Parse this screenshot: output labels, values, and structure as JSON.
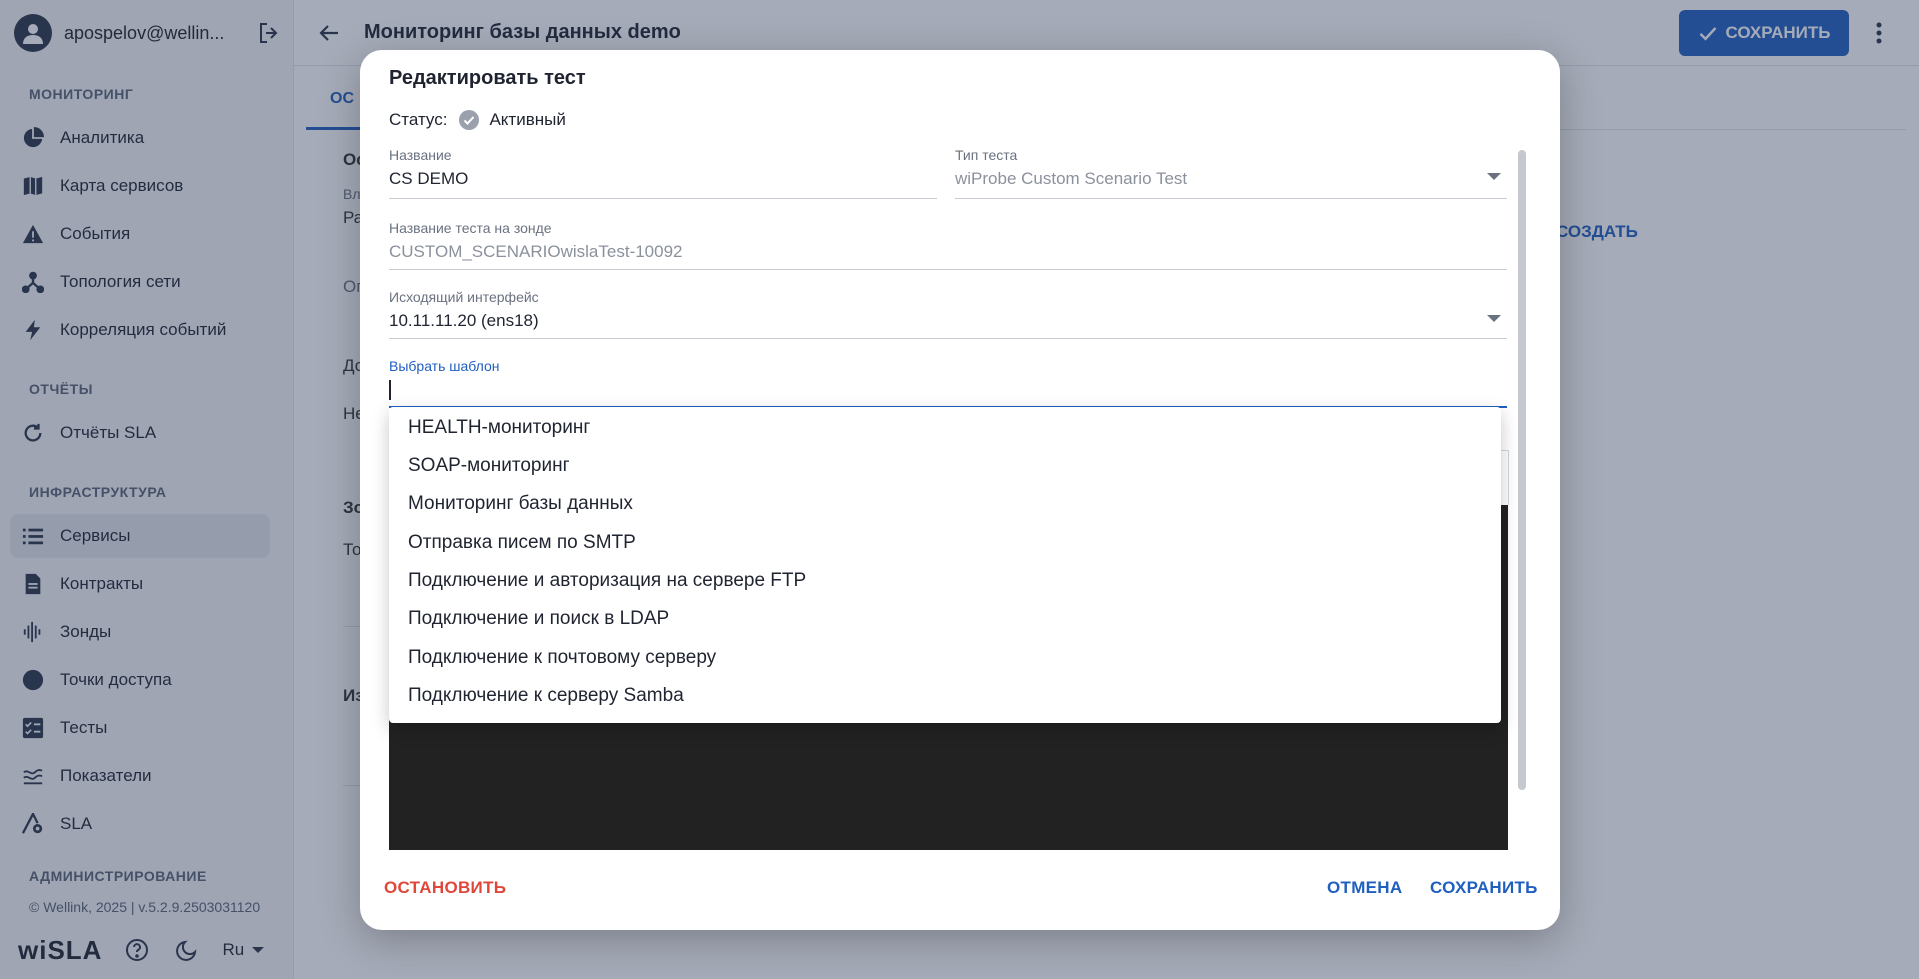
{
  "user": {
    "name": "apospelov@wellin..."
  },
  "sidebar": {
    "sections": [
      {
        "title": "МОНИТОРИНГ"
      },
      {
        "title": "ОТЧЁТЫ"
      },
      {
        "title": "ИНФРАСТРУКТУРА"
      },
      {
        "title": "АДМИНИСТРИРОВАНИЕ"
      }
    ],
    "items": [
      {
        "label": "Аналитика",
        "icon": "pie-chart-icon"
      },
      {
        "label": "Карта сервисов",
        "icon": "map-icon"
      },
      {
        "label": "События",
        "icon": "warning-icon"
      },
      {
        "label": "Топология сети",
        "icon": "topology-icon"
      },
      {
        "label": "Корреляция событий",
        "icon": "lightning-icon"
      },
      {
        "label": "Отчёты SLA",
        "icon": "refresh-icon"
      },
      {
        "label": "Сервисы",
        "icon": "list-icon",
        "active": true
      },
      {
        "label": "Контракты",
        "icon": "document-icon"
      },
      {
        "label": "Зонды",
        "icon": "waveform-icon"
      },
      {
        "label": "Точки доступа",
        "icon": "circle-icon"
      },
      {
        "label": "Тесты",
        "icon": "checklist-icon"
      },
      {
        "label": "Показатели",
        "icon": "bars-icon"
      },
      {
        "label": "SLA",
        "icon": "sla-gear-icon"
      }
    ],
    "footer": {
      "copyright": "© Wellink, 2025 | v.5.2.9.2503031120",
      "logo": "wiSLA",
      "lang": "Ru"
    }
  },
  "header": {
    "title": "Мониторинг базы данных demo",
    "save_label": "СОХРАНИТЬ"
  },
  "tabs": [
    {
      "label": "ОС"
    }
  ],
  "background": {
    "create_label": "СОЗДАТЬ",
    "fragments": [
      "Ос",
      "Вл",
      "Ра",
      "Оп",
      "До",
      "Не",
      "Зо",
      "То",
      "Из"
    ]
  },
  "dialog": {
    "title": "Редактировать тест",
    "status_label": "Статус:",
    "status_value": "Активный",
    "fields": {
      "name": {
        "label": "Название",
        "value": "CS DEMO"
      },
      "test_type": {
        "label": "Тип теста",
        "value": "wiProbe Custom Scenario Test"
      },
      "probe_name": {
        "label": "Название теста на зонде",
        "value": "CUSTOM_SCENARIOwislaTest-10092"
      },
      "interface": {
        "label": "Исходящий интерфейс",
        "value": "10.11.11.20 (ens18)"
      },
      "template": {
        "label": "Выбрать шаблон",
        "value": ""
      }
    },
    "template_options": [
      "HEALTH-мониторинг",
      "SOAP-мониторинг",
      "Мониторинг базы данных",
      "Отправка писем по SMTP",
      "Подключение и авторизация на сервере FTP",
      "Подключение и поиск в LDAP",
      "Подключение к почтовому серверу",
      "Подключение к серверу Samba"
    ],
    "buttons": {
      "stop": "ОСТАНОВИТЬ",
      "cancel": "ОТМЕНА",
      "save": "СОХРАНИТЬ"
    }
  }
}
